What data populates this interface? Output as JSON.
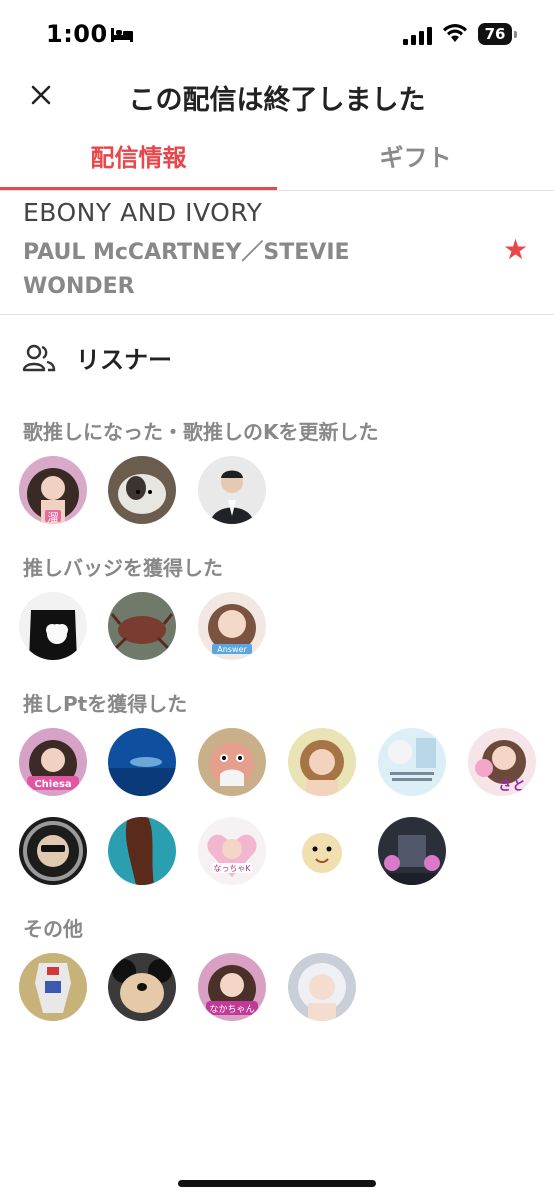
{
  "status_bar": {
    "time": "1:00",
    "battery": "76"
  },
  "header": {
    "title": "この配信は終了しました",
    "close_icon": "close-icon"
  },
  "tabs": [
    {
      "label": "配信情報",
      "active": true
    },
    {
      "label": "ギフト",
      "active": false
    }
  ],
  "song": {
    "title": "EBONY AND IVORY",
    "artist": "PAUL McCARTNEY／STEVIE WONDER",
    "favorited": true
  },
  "listeners": {
    "label": "リスナー",
    "sections": [
      {
        "label": "歌推しになった・歌推しのKを更新した",
        "count": 3
      },
      {
        "label": "推しバッジを獲得した",
        "count": 3
      },
      {
        "label": "推しPtを獲得した",
        "count": 11
      },
      {
        "label": "その他",
        "count": 4
      }
    ]
  },
  "avatar_badges": {
    "s1a1": "溜",
    "s2a3": "Answer",
    "s3a1": "Chiesa",
    "s3a6": "さと",
    "s3a9": "なっちゃK",
    "s4a3": "なかちゃん"
  },
  "colors": {
    "accent": "#e8474b",
    "muted_text": "#888888",
    "divider": "#e2e2e2"
  }
}
